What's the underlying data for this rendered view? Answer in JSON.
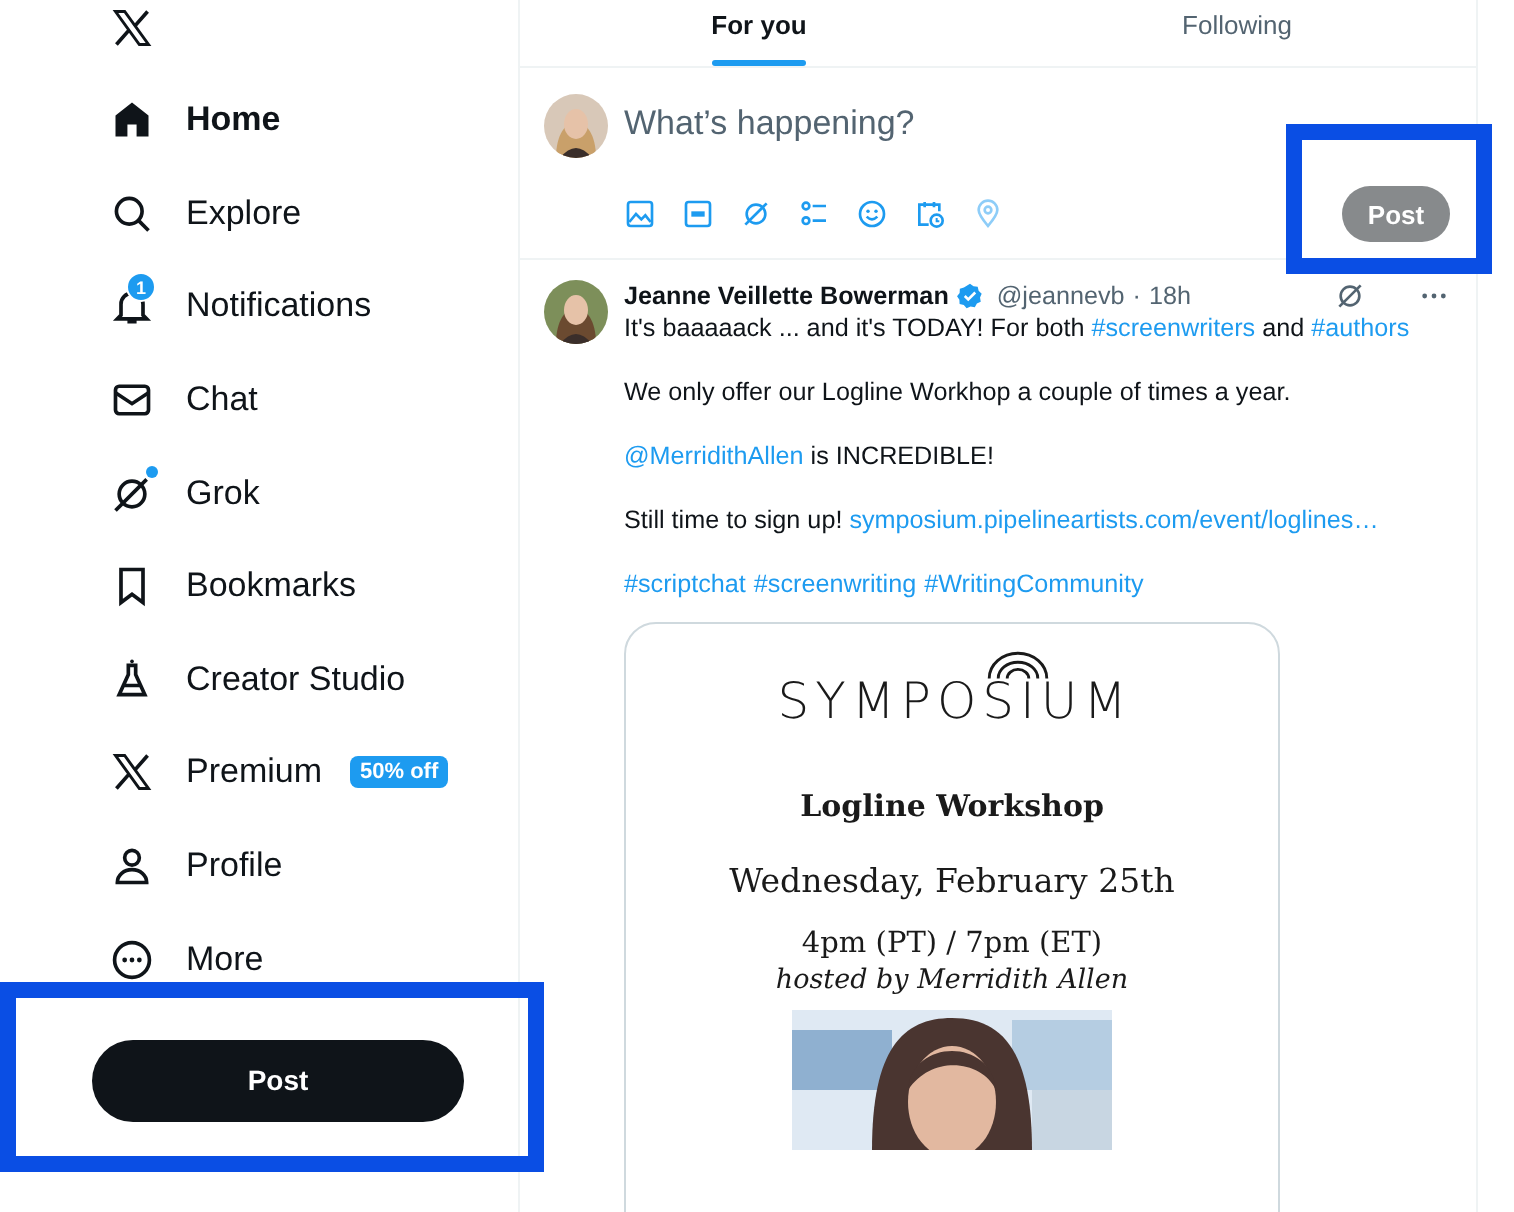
{
  "sidebar": {
    "items": [
      {
        "label": "Home",
        "selected": true,
        "unread": false
      },
      {
        "label": "Explore",
        "selected": false,
        "unread": false
      },
      {
        "label": "Notifications",
        "selected": false,
        "unread": false,
        "badge": "1"
      },
      {
        "label": "Chat",
        "selected": false,
        "unread": false
      },
      {
        "label": "Grok",
        "selected": false,
        "unread": true
      },
      {
        "label": "Bookmarks",
        "selected": false,
        "unread": false
      },
      {
        "label": "Creator Studio",
        "selected": false,
        "unread": false
      },
      {
        "label": "Premium",
        "selected": false,
        "unread": false,
        "tag": "50% off"
      },
      {
        "label": "Profile",
        "selected": false,
        "unread": false
      },
      {
        "label": "More",
        "selected": false,
        "unread": false
      }
    ],
    "post_button": "Post"
  },
  "feed": {
    "tabs": [
      {
        "label": "For you",
        "selected": true
      },
      {
        "label": "Following",
        "selected": false
      }
    ],
    "composer": {
      "placeholder": "What’s happening?",
      "post_button": {
        "label": "Post",
        "disabled": true
      }
    },
    "post": {
      "author": "Jeanne Veillette Bowerman",
      "verified": true,
      "handle": "@jeannevb",
      "separator": "·",
      "time": "18h",
      "paragraphs": [
        [
          {
            "kind": "text",
            "text": "It's baaaaack ... and it's TODAY! For both "
          },
          {
            "kind": "hashtag",
            "text": "#screenwriters"
          },
          {
            "kind": "text",
            "text": " and "
          },
          {
            "kind": "hashtag",
            "text": "#authors"
          }
        ],
        [
          {
            "kind": "text",
            "text": "We only offer our Logline Workhop a couple of times a year."
          }
        ],
        [
          {
            "kind": "mention",
            "text": "@MerridithAllen"
          },
          {
            "kind": "text",
            "text": " is INCREDIBLE!"
          }
        ],
        [
          {
            "kind": "text",
            "text": "Still time to sign up! "
          },
          {
            "kind": "url",
            "text": "symposium.pipelineartists.com/event/loglines…"
          }
        ],
        [
          {
            "kind": "hashtag",
            "text": "#scriptchat"
          },
          {
            "kind": "hashtag",
            "text": "#screenwriting"
          },
          {
            "kind": "hashtag",
            "text": "#WritingCommunity"
          }
        ]
      ],
      "media": {
        "logo": "SYMPOSIUM",
        "title": "Logline Workshop",
        "date": "Wednesday, February 25th",
        "time": "4pm (PT) / 7pm (ET)",
        "host": "hosted by Merridith Allen"
      }
    }
  }
}
